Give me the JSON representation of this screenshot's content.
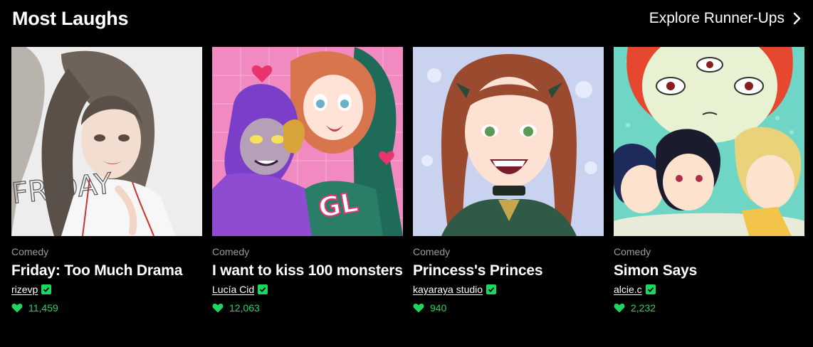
{
  "section": {
    "title": "Most Laughs",
    "explore_label": "Explore Runner-Ups"
  },
  "colors": {
    "accent": "#1ed760",
    "background": "#000000",
    "muted": "#9a9a9a"
  },
  "cards": [
    {
      "genre": "Comedy",
      "title": "Friday: Too Much Drama",
      "author": "rizevp",
      "likes": "11,459",
      "cover_text": "FRIDAY"
    },
    {
      "genre": "Comedy",
      "title": "I want to kiss 100 monsters",
      "author": "Lucía Cid",
      "likes": "12,063",
      "cover_text": "GL"
    },
    {
      "genre": "Comedy",
      "title": "Princess's Princes",
      "author": "kayaraya studio",
      "likes": "940"
    },
    {
      "genre": "Comedy",
      "title": "Simon Says",
      "author": "alcie.c",
      "likes": "2,232"
    }
  ]
}
